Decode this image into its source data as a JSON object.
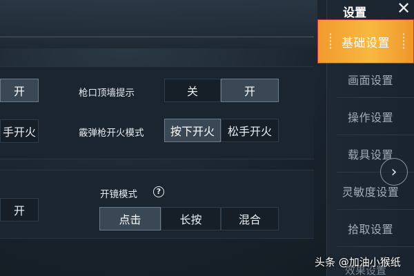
{
  "sidebar": {
    "title": "设置",
    "close_glyph": "✕",
    "items": [
      {
        "label": "基础设置",
        "active": true
      },
      {
        "label": "画面设置",
        "active": false
      },
      {
        "label": "操作设置",
        "active": false
      },
      {
        "label": "载具设置",
        "active": false
      },
      {
        "label": "灵敏度设置",
        "active": false
      },
      {
        "label": "拾取设置",
        "active": false
      },
      {
        "label": "效果设置",
        "active": false
      }
    ],
    "expand_icon": "chevron-right-icon",
    "accent_color": "#f5a93a",
    "highlight_border_color": "#c2363c"
  },
  "settings": {
    "left_partial": {
      "row1_button": "开",
      "row2_button": "手开火",
      "row3_button": "开"
    },
    "wall_hint": {
      "label": "枪口顶墙提示",
      "options": [
        "关",
        "开"
      ],
      "selected": "开"
    },
    "shotgun_fire": {
      "label": "霰弹枪开火模式",
      "options": [
        "按下开火",
        "松手开火"
      ],
      "selected": "按下开火"
    },
    "scope_mode": {
      "label": "开镜模式",
      "help_glyph": "?",
      "options": [
        "点击",
        "长按",
        "混合"
      ],
      "selected": "点击"
    }
  },
  "watermark": {
    "text": "头条 @加油小猴纸"
  }
}
